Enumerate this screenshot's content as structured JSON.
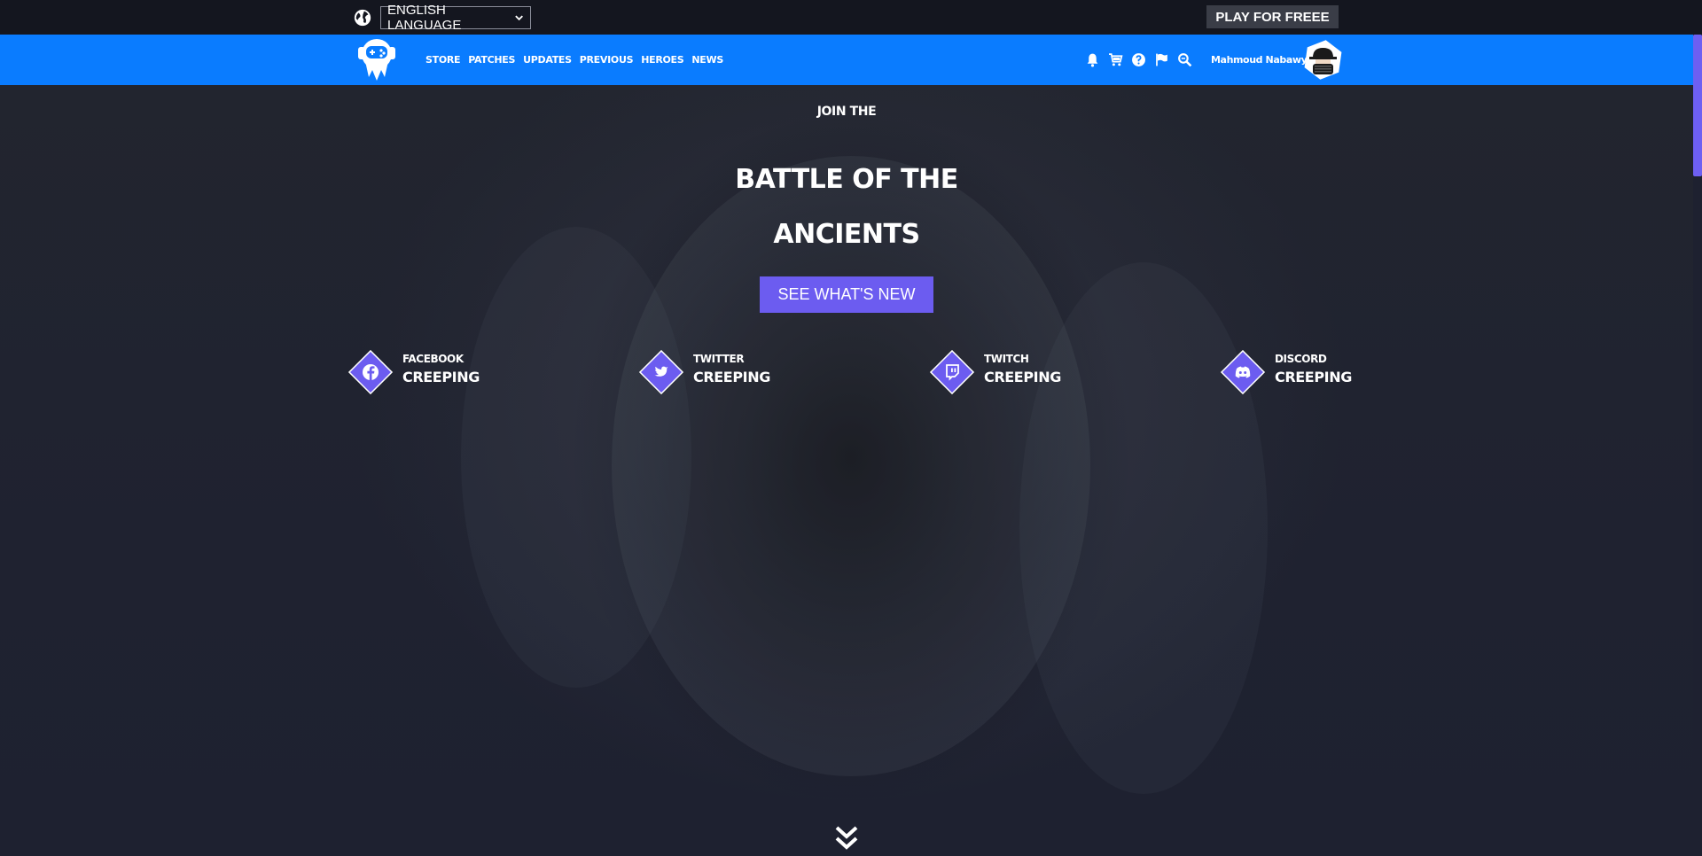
{
  "topbar": {
    "language_selected": "ENGLISH LANGUAGE",
    "play_button": "PLAY FOR FREEE"
  },
  "nav": {
    "links": [
      "STORE",
      "PATCHES",
      "UPDATES",
      "PREVIOUS",
      "HEROES",
      "NEWS"
    ],
    "icons": [
      "bell-icon",
      "cart-icon",
      "help-icon",
      "flag-icon",
      "search-icon"
    ],
    "user_name": "Mahmoud Nabawy"
  },
  "hero": {
    "subtitle": "JOIN THE",
    "title_line1": "BATTLE OF THE",
    "title_line2": "ANCIENTS",
    "cta_label": "SEE WHAT'S NEW"
  },
  "social": [
    {
      "label": "FACEBOOK",
      "value": "CREEPING",
      "icon": "facebook-icon"
    },
    {
      "label": "TWITTER",
      "value": "CREEPING",
      "icon": "twitter-icon"
    },
    {
      "label": "TWITCH",
      "value": "CREEPING",
      "icon": "twitch-icon"
    },
    {
      "label": "DISCORD",
      "value": "CREEPING",
      "icon": "discord-icon"
    }
  ],
  "colors": {
    "nav_blue": "#0a7cff",
    "accent_purple": "#6c5cf0",
    "background": "#1e2130",
    "topbar": "#14161f"
  }
}
